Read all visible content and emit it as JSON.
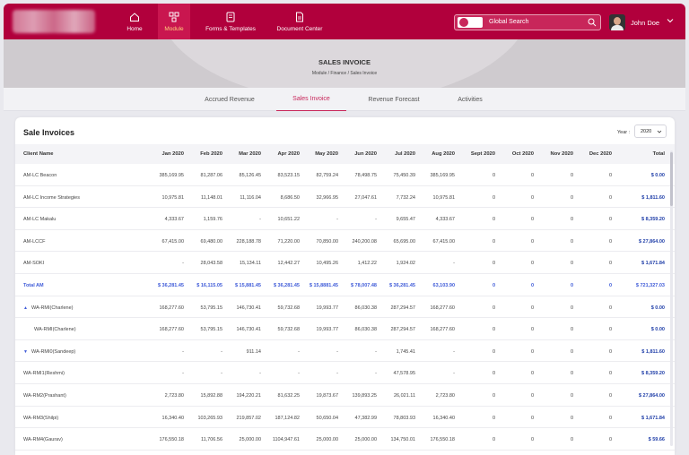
{
  "nav": {
    "items": [
      {
        "label": "Home",
        "icon": "home-icon"
      },
      {
        "label": "Module",
        "icon": "module-icon"
      },
      {
        "label": "Forms & Templates",
        "icon": "forms-icon"
      },
      {
        "label": "Document Center",
        "icon": "document-icon"
      }
    ],
    "active_index": 1,
    "search_placeholder": "Global Search",
    "user_name": "John Doe"
  },
  "banner": {
    "title": "SALES INVOICE",
    "breadcrumb": "Module / Finance / Sales Invoice"
  },
  "tabs": [
    "Accrued Revenue",
    "Sales Invoice",
    "Revenue Forecast",
    "Activities"
  ],
  "active_tab": 1,
  "card": {
    "title": "Sale Invoices",
    "year_label": "Year :",
    "year_value": "2020"
  },
  "table": {
    "columns": [
      "Client Name",
      "Jan 2020",
      "Feb 2020",
      "Mar 2020",
      "Apr 2020",
      "May 2020",
      "Jun 2020",
      "Jul 2020",
      "Aug 2020",
      "Sept 2020",
      "Oct 2020",
      "Nov 2020",
      "Dec 2020",
      "Total"
    ],
    "rows": [
      {
        "name": "AM-LC Beacon",
        "values": [
          "385,169.95",
          "81,287.06",
          "85,126.45",
          "83,523.15",
          "82,759.24",
          "78,498.75",
          "75,450.39",
          "385,169.95",
          "0",
          "0",
          "0",
          "0"
        ],
        "total": "$ 0.00"
      },
      {
        "name": "AM-LC Income Strategies",
        "values": [
          "10,975.81",
          "11,148.01",
          "11,116.04",
          "8,686.50",
          "32,966.95",
          "27,047.61",
          "7,732.24",
          "10,975.81",
          "0",
          "0",
          "0",
          "0"
        ],
        "total": "$ 1,811.60"
      },
      {
        "name": "AM-LC Makalu",
        "values": [
          "4,333.67",
          "1,159.76",
          "-",
          "10,651.22",
          "-",
          "-",
          "9,655.47",
          "4,333.67",
          "0",
          "0",
          "0",
          "0"
        ],
        "total": "$ 8,359.20"
      },
      {
        "name": "AM-LCCF",
        "values": [
          "67,415.00",
          "69,480.00",
          "228,188.78",
          "71,220.00",
          "70,850.00",
          "240,200.08",
          "65,695.00",
          "67,415.00",
          "0",
          "0",
          "0",
          "0"
        ],
        "total": "$ 27,864.00"
      },
      {
        "name": "AM-SOKI",
        "values": [
          "-",
          "28,043.58",
          "15,134.11",
          "12,442.27",
          "10,495.26",
          "1,412.22",
          "1,924.02",
          "-",
          "0",
          "0",
          "0",
          "0"
        ],
        "total": "$ 1,671.84"
      },
      {
        "name": "Total  AM",
        "values": [
          "$ 36,281.45",
          "$ 16,115.05",
          "$ 15,881.45",
          "$ 36,281.45",
          "$ 15,8881.45",
          "$ 78,007.48",
          "$ 36,281.45",
          "63,103.90",
          "0",
          "0",
          "0",
          "0"
        ],
        "total": "$ 721,327.03",
        "is_total": true
      },
      {
        "name": "WA-RMI(Charlene)",
        "values": [
          "168,277.60",
          "53,795.15",
          "146,730.41",
          "59,732.68",
          "19,993.77",
          "86,030.38",
          "287,294.57",
          "168,277.60",
          "0",
          "0",
          "0",
          "0"
        ],
        "total": "$ 0.00",
        "caret": "up"
      },
      {
        "name": "WA-RMI(Charlene)",
        "values": [
          "168,277.60",
          "53,795.15",
          "146,730.41",
          "59,732.68",
          "19,993.77",
          "86,030.38",
          "287,294.57",
          "168,277.60",
          "0",
          "0",
          "0",
          "0"
        ],
        "total": "$ 0.00",
        "indent": true
      },
      {
        "name": "WA-RMI0(Sandeep)",
        "values": [
          "-",
          "-",
          "911.14",
          "-",
          "-",
          "-",
          "1,745.41",
          "-",
          "0",
          "0",
          "0",
          "0"
        ],
        "total": "$ 1,811.60",
        "caret": "down"
      },
      {
        "name": "WA-RMI1(Reshmi)",
        "values": [
          "-",
          "-",
          "-",
          "-",
          "-",
          "-",
          "47,578.95",
          "-",
          "0",
          "0",
          "0",
          "0"
        ],
        "total": "$ 8,359.20"
      },
      {
        "name": "WA-RM2(Prashant)",
        "values": [
          "2,723.80",
          "15,892.88",
          "194,220.21",
          "81,632.25",
          "19,873.67",
          "139,893.25",
          "26,021.11",
          "2,723.80",
          "0",
          "0",
          "0",
          "0"
        ],
        "total": "$ 27,864.00"
      },
      {
        "name": "WA-RM3(Shilpi)",
        "values": [
          "16,340.40",
          "103,265.93",
          "219,857.02",
          "187,124.82",
          "50,650.04",
          "47,382.99",
          "78,803.93",
          "16,340.40",
          "0",
          "0",
          "0",
          "0"
        ],
        "total": "$ 1,671.84"
      },
      {
        "name": "WA-RM4(Gaurav)",
        "values": [
          "176,550.18",
          "11,706.56",
          "25,000.00",
          "1104,947.61",
          "25,000.00",
          "25,000.00",
          "134,750.01",
          "176,550.18",
          "0",
          "0",
          "0",
          "0"
        ],
        "total": "$ 59.66"
      }
    ]
  }
}
